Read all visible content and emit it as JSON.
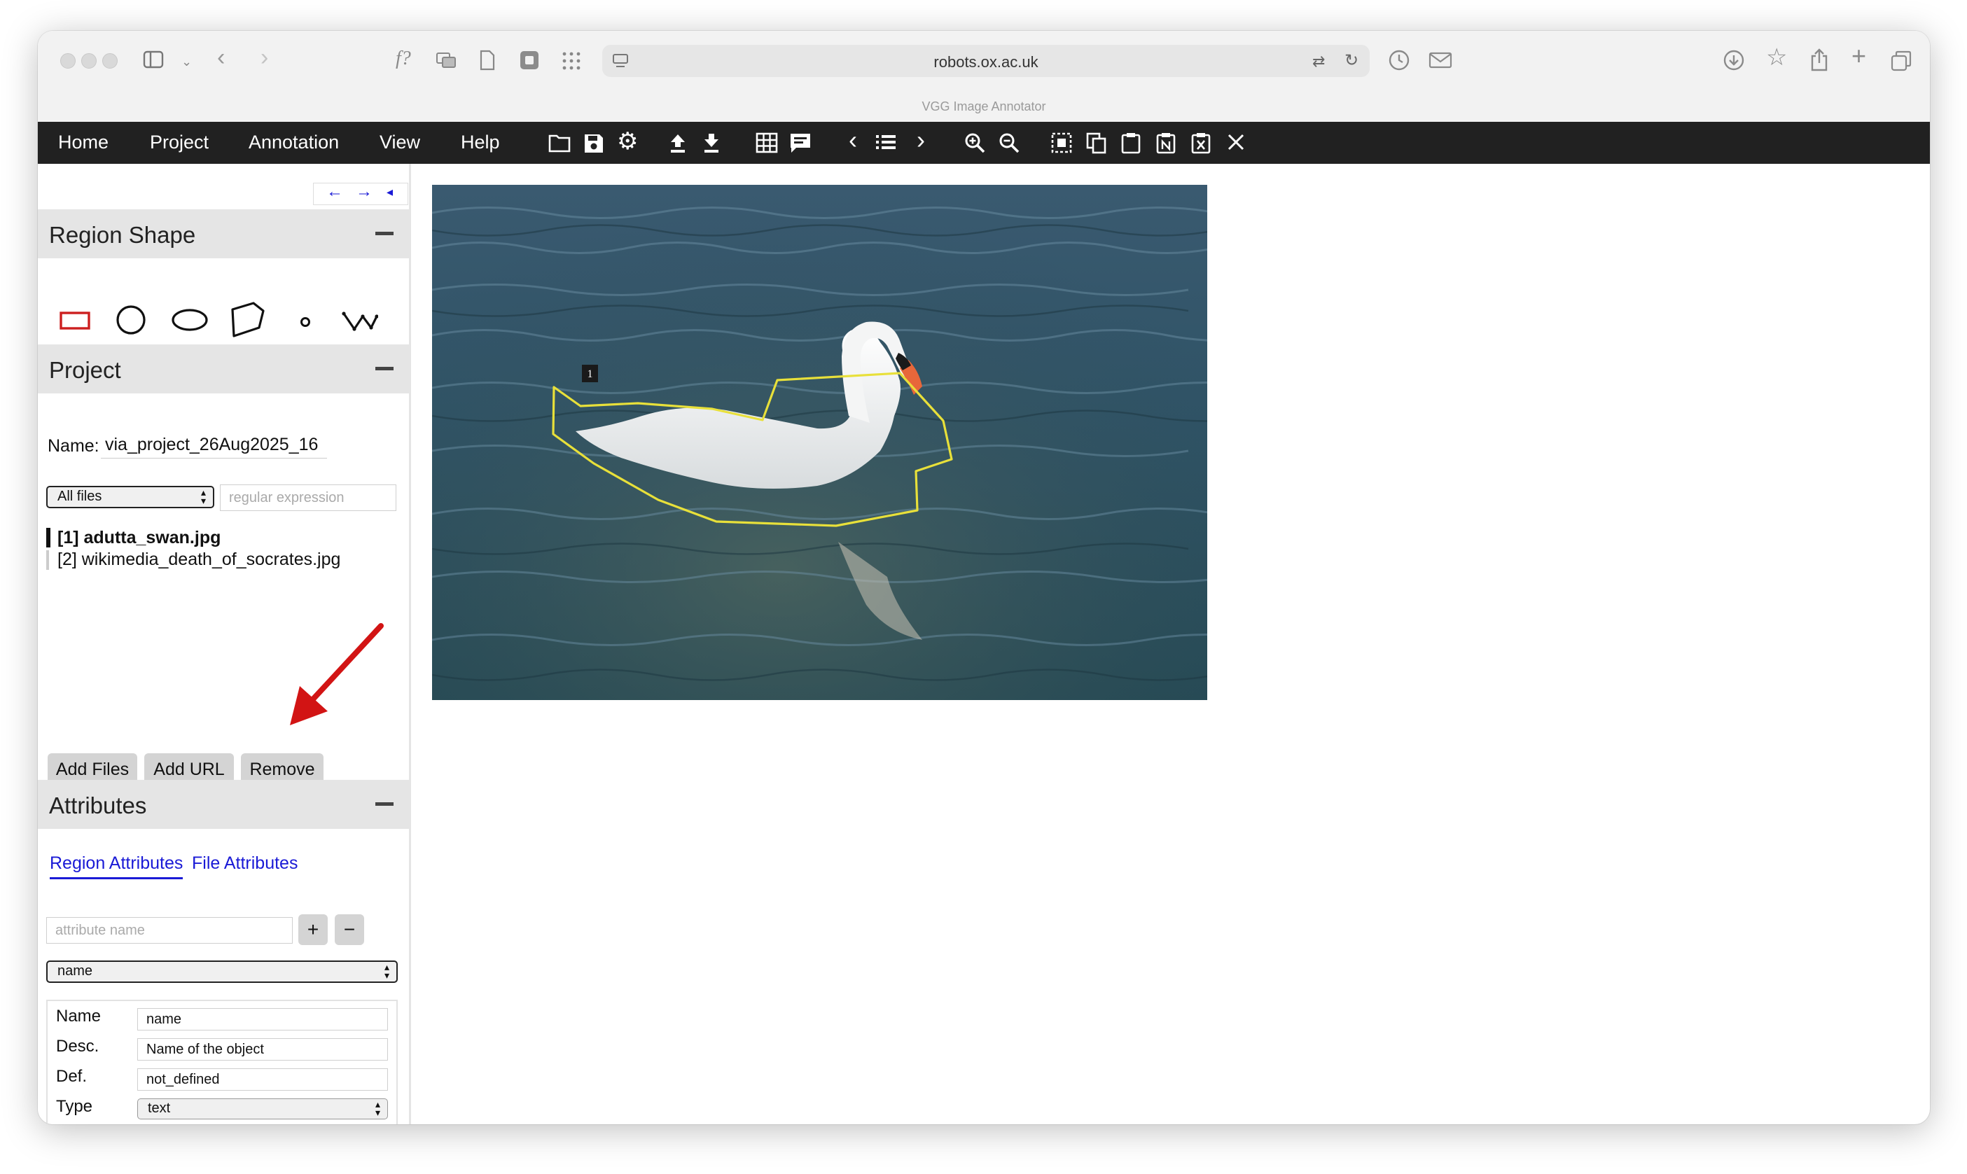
{
  "browser": {
    "address": "robots.ox.ac.uk",
    "tab_title": "VGG Image Annotator"
  },
  "menu": {
    "items": [
      "Home",
      "Project",
      "Annotation",
      "View",
      "Help"
    ]
  },
  "panel_nav": {
    "left": "←",
    "right": "→",
    "collapse": "◂"
  },
  "region_shape": {
    "title": "Region Shape"
  },
  "project": {
    "title": "Project",
    "name_label": "Name:",
    "name_value": "via_project_26Aug2025_16",
    "filter_select": "All files",
    "filter_placeholder": "regular expression",
    "files": [
      {
        "label": "[1] adutta_swan.jpg",
        "selected": true
      },
      {
        "label": "[2] wikimedia_death_of_socrates.jpg",
        "selected": false
      }
    ],
    "buttons": {
      "add_files": "Add Files",
      "add_url": "Add URL",
      "remove": "Remove"
    }
  },
  "attributes": {
    "title": "Attributes",
    "tabs": {
      "region": "Region Attributes",
      "file": "File Attributes"
    },
    "name_placeholder": "attribute name",
    "add_btn": "+",
    "remove_btn": "−",
    "attr_select": "name",
    "table": {
      "name_label": "Name",
      "name_value": "name",
      "desc_label": "Desc.",
      "desc_value": "Name of the object",
      "def_label": "Def.",
      "def_value": "not_defined",
      "type_label": "Type",
      "type_value": "text"
    }
  },
  "canvas": {
    "region_label": "1"
  },
  "colors": {
    "menubar": "#212121",
    "section_header": "#e5e5e5",
    "active_shape": "#cc1f1f",
    "region_outline": "#e8e03a",
    "link_blue": "#1a1ad6",
    "annotation_arrow": "#d21414"
  }
}
